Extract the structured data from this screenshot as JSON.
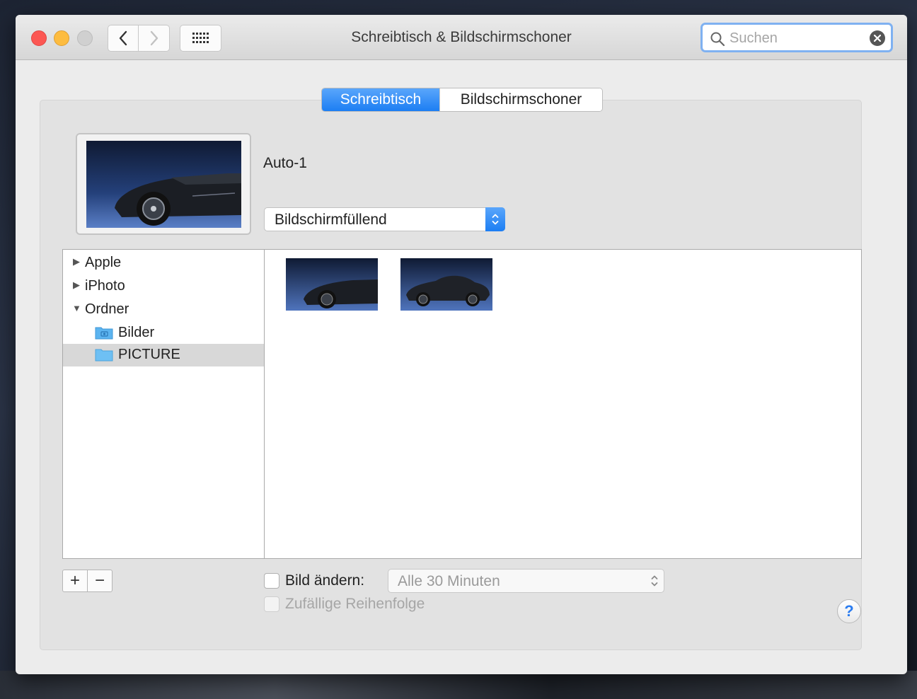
{
  "window": {
    "title": "Schreibtisch & Bildschirmschoner"
  },
  "search": {
    "placeholder": "Suchen",
    "value": ""
  },
  "tabs": [
    {
      "label": "Schreibtisch",
      "active": true
    },
    {
      "label": "Bildschirmschoner",
      "active": false
    }
  ],
  "picture": {
    "name": "Auto-1",
    "fit_option": "Bildschirmfüllend"
  },
  "sources": [
    {
      "label": "Apple",
      "expanded": false
    },
    {
      "label": "iPhoto",
      "expanded": false
    },
    {
      "label": "Ordner",
      "expanded": true,
      "children": [
        {
          "label": "Bilder",
          "icon": "folder-camera-icon",
          "selected": false
        },
        {
          "label": "PICTURE",
          "icon": "folder-icon",
          "selected": true
        }
      ]
    }
  ],
  "buttons": {
    "add": "+",
    "remove": "−",
    "help": "?"
  },
  "options": {
    "change_picture_label": "Bild ändern:",
    "change_picture_checked": false,
    "interval": "Alle 30 Minuten",
    "random_order_label": "Zufällige Reihenfolge",
    "random_order_enabled": false
  },
  "colors": {
    "accent": "#1c7ef3",
    "close": "#fc5753",
    "minimize": "#fdbc40",
    "search_focus": "#7fb1f1"
  }
}
